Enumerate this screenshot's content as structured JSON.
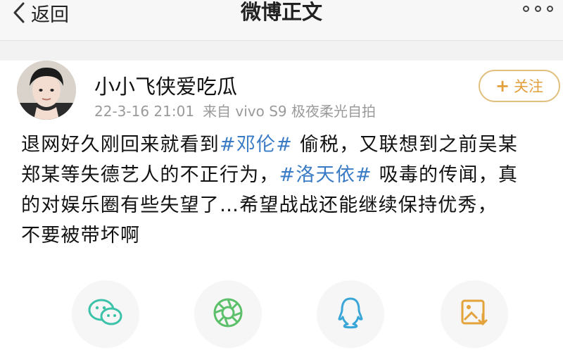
{
  "nav": {
    "back_label": "返回",
    "title": "微博正文"
  },
  "post": {
    "username": "小小飞侠爱吃瓜",
    "timestamp": "22-3-16 21:01",
    "source": "来自 vivo S9 极夜柔光自拍",
    "follow_label": "关注",
    "follow_plus": "+",
    "content": {
      "l1_a": "退网好久刚回来就看到",
      "l1_tag": "#邓伦#",
      "l1_b": " 偷税，又联想到之前吴某",
      "l2_a": "郑某等失德艺人的不正行为，",
      "l2_tag": "#洛天依#",
      "l2_b": " 吸毒的传闻，真",
      "l3": "的对娱乐圈有些失望了…希望战战还能继续保持优秀，",
      "l4": "不要被带坏啊"
    }
  },
  "share": [
    {
      "icon": "wechat-icon",
      "color": "#3cc2a9"
    },
    {
      "icon": "moments-icon",
      "color": "#5cc06a"
    },
    {
      "icon": "qq-icon",
      "color": "#3aa6d8"
    },
    {
      "icon": "save-image-icon",
      "color": "#e3a33a"
    }
  ],
  "colors": {
    "hashtag": "#3a7bc6",
    "follow_accent": "#e2a03c",
    "meta_gray": "#9a9a9a"
  }
}
